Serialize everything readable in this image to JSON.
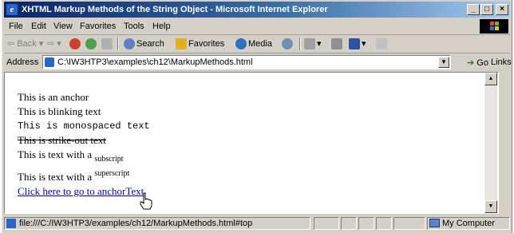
{
  "window": {
    "title": "XHTML Markup Methods of the String Object - Microsoft Internet Explorer"
  },
  "menu": [
    "File",
    "Edit",
    "View",
    "Favorites",
    "Tools",
    "Help"
  ],
  "toolbar": {
    "back": "Back",
    "search": "Search",
    "favorites": "Favorites",
    "media": "Media"
  },
  "address": {
    "label": "Address",
    "url": "C:\\IW3HTP3\\examples\\ch12\\MarkupMethods.html",
    "go": "Go",
    "links": "Links »"
  },
  "content": {
    "anchor": "This is an anchor",
    "blink": "This is blinking text",
    "mono": "This is monospaced text",
    "strike": "This is strike-out text",
    "sub_prefix": "This is text with a",
    "sub": "subscript",
    "sup_prefix": "This is text with a",
    "sup": "superscript",
    "link": "Click here to go to anchorText"
  },
  "status": {
    "text": "file:///C:/IW3HTP3/examples/ch12/MarkupMethods.html#top",
    "zone": "My Computer"
  },
  "icons": {
    "app": "ie-icon",
    "page": "page-icon",
    "computer": "computer-icon",
    "cursor": "hand-cursor-icon"
  },
  "colors": {
    "titlebar_start": "#0a246a",
    "titlebar_end": "#a6caf0",
    "chrome": "#d4d0c8",
    "link": "#0000cc"
  }
}
